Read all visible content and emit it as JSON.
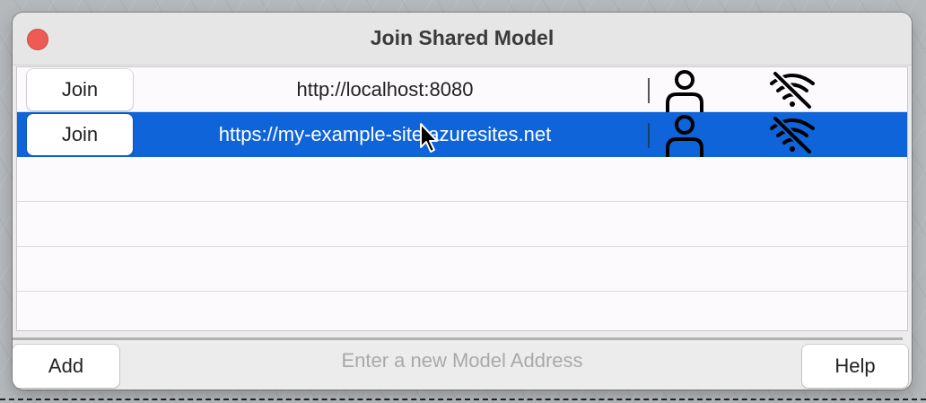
{
  "window": {
    "title": "Join Shared Model",
    "close_color": "#ed5b55"
  },
  "list": {
    "selection_color": "#0f64d9",
    "rows": [
      {
        "join_label": "Join",
        "address": "http://localhost:8080",
        "user_icon": "person-icon",
        "status_icon": "wifi-off-icon",
        "selected": false
      },
      {
        "join_label": "Join",
        "address": "https://my-example-site.azuresites.net",
        "user_icon": "person-icon",
        "status_icon": "wifi-off-icon",
        "selected": true
      }
    ],
    "empty_rows": 4
  },
  "footer": {
    "add_label": "Add",
    "address_placeholder": "Enter a new Model Address",
    "address_value": "",
    "help_label": "Help"
  }
}
